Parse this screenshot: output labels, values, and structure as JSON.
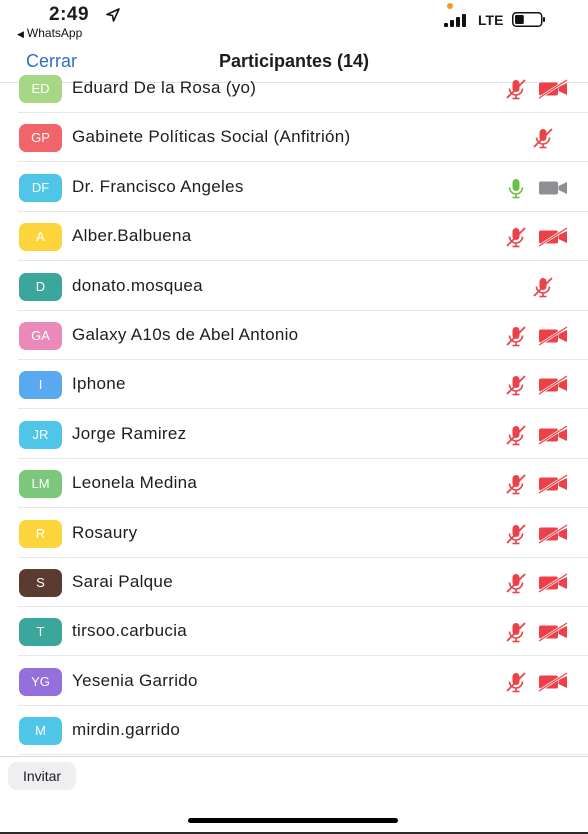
{
  "status_bar": {
    "time": "2:49",
    "back_app": "WhatsApp",
    "network": "LTE",
    "battery_level": 0.35
  },
  "nav": {
    "close_label": "Cerrar",
    "title": "Participantes (14)"
  },
  "participants": [
    {
      "initials": "ED",
      "name": "Eduard De la Rosa (yo)",
      "color": "#a6d785",
      "mic": "muted",
      "camera": "off"
    },
    {
      "initials": "GP",
      "name": "Gabinete Políticas Social (Anfitrión)",
      "color": "#f0646a",
      "mic": "muted",
      "camera": "none"
    },
    {
      "initials": "DF",
      "name": "Dr. Francisco Angeles",
      "color": "#4fc6e8",
      "mic": "on",
      "camera": "on-gray"
    },
    {
      "initials": "A",
      "name": "Alber.Balbuena",
      "color": "#fcd53c",
      "mic": "muted",
      "camera": "off"
    },
    {
      "initials": "D",
      "name": "donato.mosquea",
      "color": "#3aa69c",
      "mic": "muted",
      "camera": "none"
    },
    {
      "initials": "GA",
      "name": "Galaxy A10s de Abel Antonio",
      "color": "#e98ab8",
      "mic": "muted",
      "camera": "off"
    },
    {
      "initials": "I",
      "name": "Iphone",
      "color": "#58a9f0",
      "mic": "muted",
      "camera": "off"
    },
    {
      "initials": "JR",
      "name": "Jorge Ramirez",
      "color": "#4fc6e8",
      "mic": "muted",
      "camera": "off"
    },
    {
      "initials": "LM",
      "name": "Leonela Medina",
      "color": "#7bc77b",
      "mic": "muted",
      "camera": "off"
    },
    {
      "initials": "R",
      "name": "Rosaury",
      "color": "#fcd53c",
      "mic": "muted",
      "camera": "off"
    },
    {
      "initials": "S",
      "name": "Sarai Palque",
      "color": "#5b3b30",
      "mic": "muted",
      "camera": "off"
    },
    {
      "initials": "T",
      "name": "tirsoo.carbucia",
      "color": "#3aa69c",
      "mic": "muted",
      "camera": "off"
    },
    {
      "initials": "YG",
      "name": "Yesenia Garrido",
      "color": "#9370db",
      "mic": "muted",
      "camera": "off"
    },
    {
      "initials": "M",
      "name": "mirdin.garrido",
      "color": "#4fc6e8",
      "mic": "none",
      "camera": "none"
    }
  ],
  "footer": {
    "invite_label": "Invitar"
  },
  "colors": {
    "accent_blue": "#2d71c6",
    "muted_red": "#ec4148",
    "mic_green": "#6ac045",
    "camera_gray": "#8e8e93"
  }
}
